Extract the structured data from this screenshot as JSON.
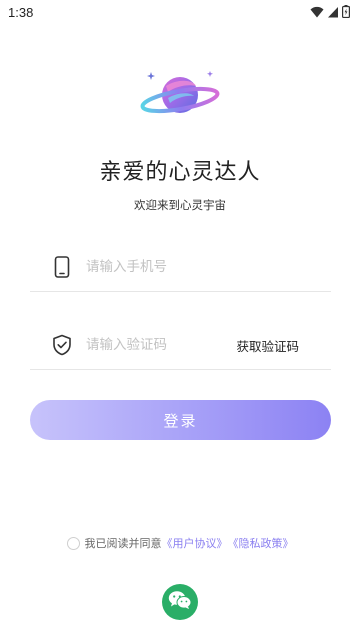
{
  "status_bar": {
    "time": "1:38",
    "icons": [
      "wifi-icon",
      "signal-icon",
      "battery-icon"
    ]
  },
  "header": {
    "logo": "planet-logo",
    "title": "亲爱的心灵达人",
    "subtitle": "欢迎来到心灵宇宙"
  },
  "form": {
    "phone": {
      "icon": "phone-icon",
      "placeholder": "请输入手机号",
      "value": ""
    },
    "code": {
      "icon": "shield-check-icon",
      "placeholder": "请输入验证码",
      "value": "",
      "get_code_label": "获取验证码"
    },
    "login_label": "登录"
  },
  "agreement": {
    "prefix": "我已阅读并同意",
    "user_agreement": "《用户协议》",
    "privacy_policy": "《隐私政策》",
    "checked": false
  },
  "social_login": {
    "icon": "wechat-icon"
  },
  "colors": {
    "accent": "#8a7ff0",
    "button_gradient_start": "#c7c3fb",
    "button_gradient_end": "#8c82f3",
    "wechat_green": "#2aae67"
  }
}
